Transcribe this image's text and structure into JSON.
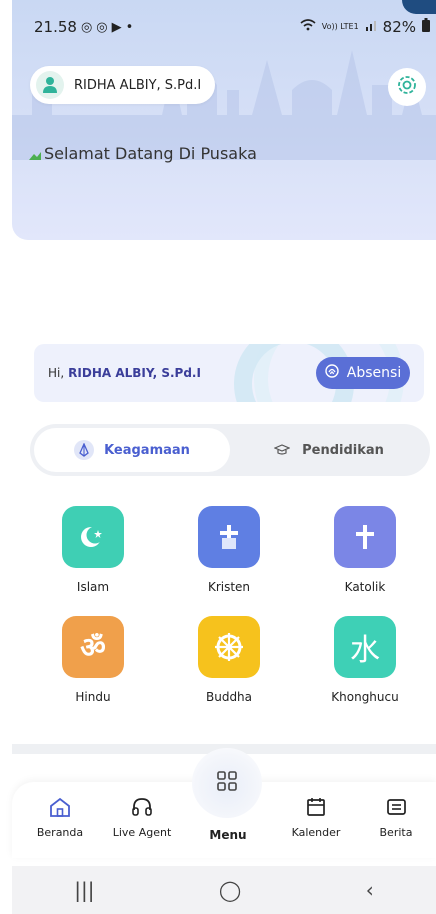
{
  "status_bar": {
    "time": "21.58",
    "battery": "82%",
    "volte_label": "Vo)) LTE1"
  },
  "user": {
    "name": "RIDHA ALBIY, S.Pd.I"
  },
  "welcome_text": "Selamat Datang Di Pusaka",
  "greeting": {
    "prefix": "Hi,",
    "name": "RIDHA ALBIY, S.Pd.I",
    "button": "Absensi"
  },
  "tabs": [
    {
      "label": "Keagamaan",
      "active": true,
      "icon": "praying-hands-icon"
    },
    {
      "label": "Pendidikan",
      "active": false,
      "icon": "graduation-cap-icon"
    }
  ],
  "religions": [
    {
      "label": "Islam",
      "color": "#3fcfb4",
      "icon": "crescent-star-icon"
    },
    {
      "label": "Kristen",
      "color": "#5f7fe3",
      "icon": "church-icon"
    },
    {
      "label": "Katolik",
      "color": "#7b86e6",
      "icon": "cross-icon"
    },
    {
      "label": "Hindu",
      "color": "#f0a04b",
      "icon": "om-icon"
    },
    {
      "label": "Buddha",
      "color": "#f6c21d",
      "icon": "dharma-wheel-icon"
    },
    {
      "label": "Khonghucu",
      "color": "#3ed0b6",
      "icon": "water-character-icon"
    }
  ],
  "bottom_nav": {
    "items": [
      {
        "label": "Beranda",
        "icon": "home-icon"
      },
      {
        "label": "Live Agent",
        "icon": "headset-icon"
      },
      {
        "label": "Menu",
        "icon": "grid-icon"
      },
      {
        "label": "Kalender",
        "icon": "calendar-icon"
      },
      {
        "label": "Berita",
        "icon": "news-icon"
      }
    ]
  },
  "android_nav": {
    "recents": "|||",
    "home": "◯",
    "back": "‹"
  },
  "colors": {
    "accent": "#4a5fd0",
    "header_bg": "#d2dcf5",
    "name_color": "#3b3e9a"
  }
}
